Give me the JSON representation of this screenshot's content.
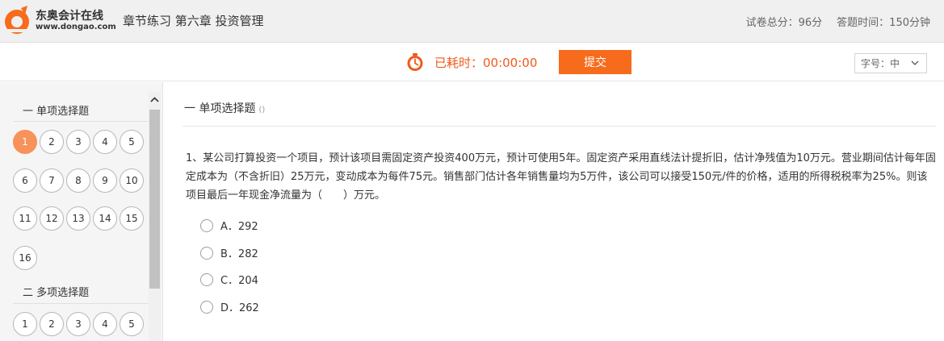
{
  "header": {
    "logo_cn": "东奥会计在线",
    "logo_en": "www.dongao.com",
    "title": "章节练习 第六章 投资管理",
    "total_score": "试卷总分：96分",
    "time_limit": "答题时间：150分钟",
    "brand_color": "#f76b1c"
  },
  "toolbar": {
    "timer_icon": "stopwatch-icon",
    "timer_label": "已耗时：00:00:00",
    "submit_label": "提交",
    "font_size_label": "字号：中",
    "font_size_icon": "chevron-down-icon"
  },
  "sidebar": {
    "sections": [
      {
        "title": "一 单项选择题",
        "numbers": [
          "1",
          "2",
          "3",
          "4",
          "5",
          "6",
          "7",
          "8",
          "9",
          "10",
          "11",
          "12",
          "13",
          "14",
          "15",
          "16"
        ],
        "active": "1"
      },
      {
        "title": "二 多项选择题",
        "numbers": [
          "1",
          "2",
          "3",
          "4",
          "5"
        ]
      }
    ]
  },
  "main": {
    "section_title": "一 单项选择题",
    "section_paren": "()",
    "question": "1、某公司打算投资一个项目，预计该项目需固定资产投资400万元，预计可使用5年。固定资产采用直线法计提折旧，估计净残值为10万元。营业期间估计每年固定成本为（不含折旧）25万元，变动成本为每件75元。销售部门估计各年销售量均为5万件，该公司可以接受150元/件的价格，适用的所得税税率为25%。则该项目最后一年现金净流量为（　　）万元。",
    "options": [
      "A．292",
      "B．282",
      "C．204",
      "D．262"
    ]
  }
}
